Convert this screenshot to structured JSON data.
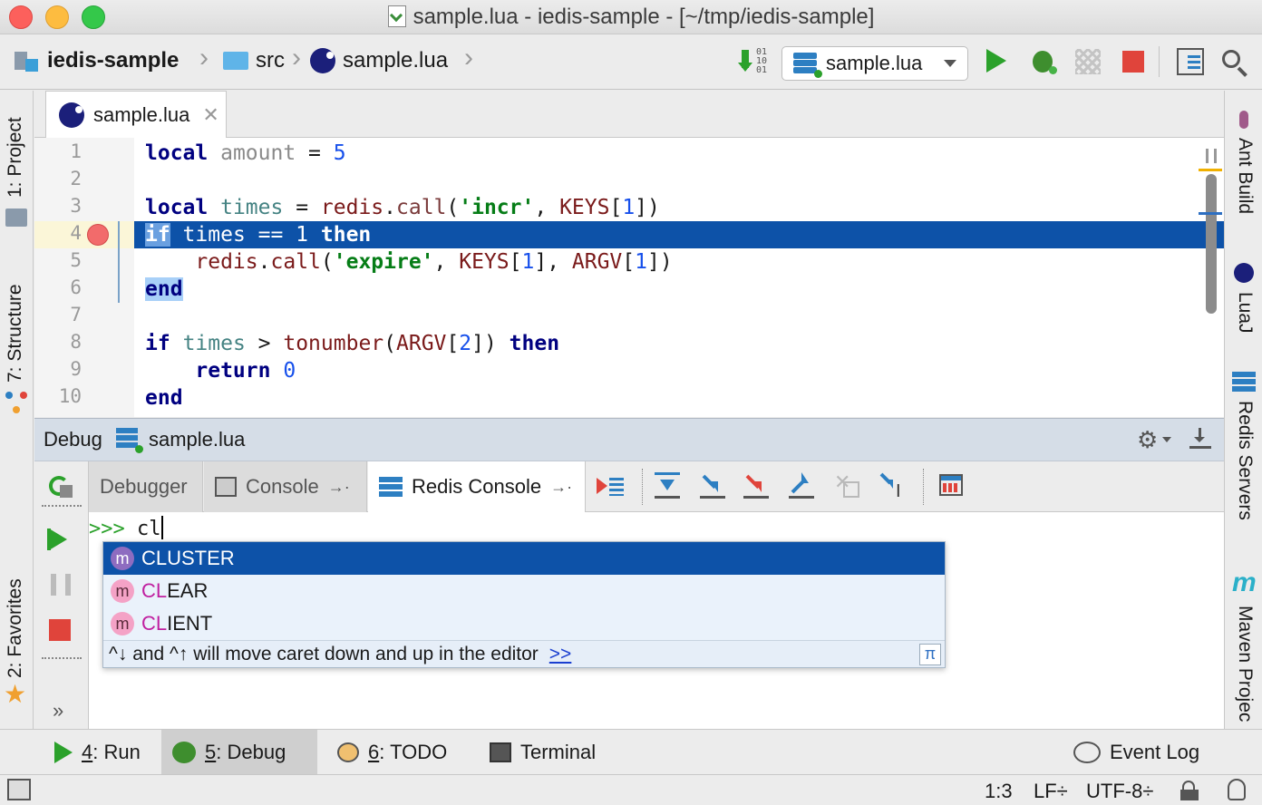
{
  "window": {
    "title": "sample.lua - iedis-sample - [~/tmp/iedis-sample]"
  },
  "breadcrumb": {
    "project": "iedis-sample",
    "folder": "src",
    "file": "sample.lua"
  },
  "run_config": {
    "selected": "sample.lua"
  },
  "left_tools": {
    "project": "1: Project",
    "structure": "7: Structure",
    "favorites": "2: Favorites"
  },
  "right_tools": {
    "ant": "Ant Build",
    "luaj": "LuaJ",
    "redis": "Redis Servers",
    "maven": "Maven Projec",
    "maven_icon": "m"
  },
  "editor": {
    "tab": "sample.lua",
    "line_numbers": [
      "1",
      "2",
      "3",
      "4",
      "5",
      "6",
      "7",
      "8",
      "9",
      "10"
    ],
    "lines": [
      "local amount = 5",
      "",
      "local times = redis.call('incr', KEYS[1])",
      "if times == 1 then",
      "    redis.call('expire', KEYS[1], ARGV[1])",
      "end",
      "",
      "if times > tonumber(ARGV[2]) then",
      "    return 0",
      "end"
    ]
  },
  "debug": {
    "label": "Debug",
    "config": "sample.lua",
    "tabs": {
      "debugger": "Debugger",
      "console": "Console",
      "redis_console": "Redis Console"
    },
    "prompt": ">>>",
    "input": "cl",
    "completion": {
      "badge": "m",
      "items": [
        {
          "text": "CLUSTER",
          "match": "CL",
          "rest": "USTER"
        },
        {
          "text": "CLEAR",
          "match": "CL",
          "rest": "EAR"
        },
        {
          "text": "CLIENT",
          "match": "CL",
          "rest": "IENT"
        }
      ],
      "hint": "^↓ and ^↑ will move caret down and up in the editor",
      "hint_link": ">>",
      "pi": "π"
    }
  },
  "bottom_tools": {
    "run": {
      "num": "4",
      "label": ": Run"
    },
    "debug": {
      "num": "5",
      "label": ": Debug"
    },
    "todo": {
      "num": "6",
      "label": ": TODO"
    },
    "terminal": "Terminal",
    "event_log": "Event Log",
    "expand": "»"
  },
  "status": {
    "position": "1:3",
    "line_sep": "LF÷",
    "encoding": "UTF-8÷"
  },
  "colors": {
    "selection": "#0d52a8",
    "completion_selected": "#0d52a8",
    "run_green": "#2ba12b",
    "stop_red": "#e0443b"
  }
}
